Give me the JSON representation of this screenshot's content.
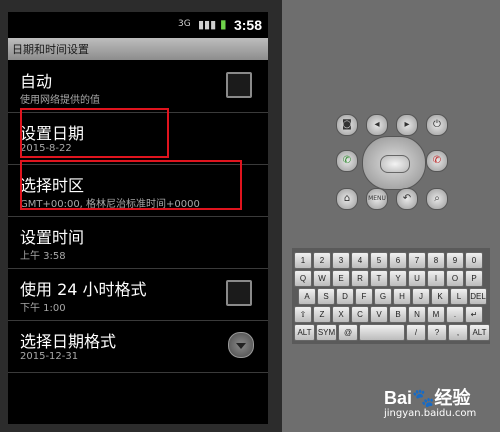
{
  "status_bar": {
    "network_label": "3G",
    "time": "3:58"
  },
  "title_bar": {
    "title": "日期和时间设置"
  },
  "settings": [
    {
      "title": "自动",
      "subtitle": "使用网络提供的值",
      "control": "checkbox",
      "checked": false
    },
    {
      "title": "设置日期",
      "subtitle": "2015-8-22",
      "control": "none",
      "highlighted": true
    },
    {
      "title": "选择时区",
      "subtitle": "GMT+00:00, 格林尼治标准时间+0000",
      "control": "none",
      "highlighted": true
    },
    {
      "title": "设置时间",
      "subtitle": "上午 3:58",
      "control": "none"
    },
    {
      "title": "使用 24 小时格式",
      "subtitle": "下午 1:00",
      "control": "checkbox",
      "checked": false
    },
    {
      "title": "选择日期格式",
      "subtitle": "2015-12-31",
      "control": "dropdown"
    }
  ],
  "emulator": {
    "button_labels": {
      "menu": "MENU"
    },
    "keyboard_rows": [
      [
        "1",
        "2",
        "3",
        "4",
        "5",
        "6",
        "7",
        "8",
        "9",
        "0"
      ],
      [
        "Q",
        "W",
        "E",
        "R",
        "T",
        "Y",
        "U",
        "I",
        "O",
        "P"
      ],
      [
        "A",
        "S",
        "D",
        "F",
        "G",
        "H",
        "J",
        "K",
        "L",
        "DEL"
      ],
      [
        "⇧",
        "Z",
        "X",
        "C",
        "V",
        "B",
        "N",
        "M",
        ".",
        "↵"
      ],
      [
        "ALT",
        "SYM",
        "@",
        "",
        "/",
        "?",
        ",",
        "ALT"
      ]
    ]
  },
  "watermark": {
    "brand": "Bai🐾经验",
    "url": "jingyan.baidu.com"
  }
}
